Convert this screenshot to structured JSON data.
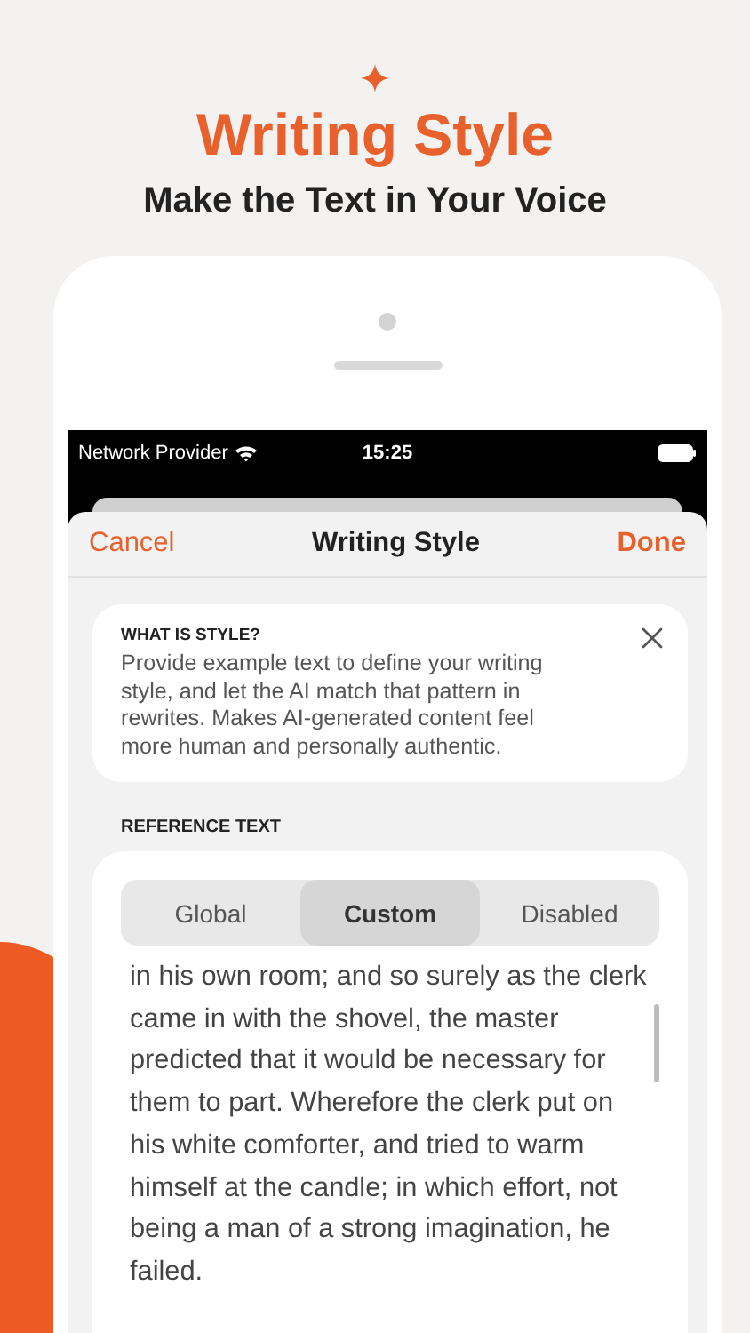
{
  "header": {
    "title": "Writing Style",
    "subtitle": "Make the Text in Your Voice"
  },
  "status_bar": {
    "carrier": "Network Provider",
    "time": "15:25"
  },
  "nav_bar": {
    "cancel": "Cancel",
    "title": "Writing Style",
    "done": "Done"
  },
  "info_card": {
    "heading": "WHAT IS STYLE?",
    "body": "Provide example text to define your writing style, and let the AI match that pattern in rewrites. Makes AI-generated content feel more human and personally authentic."
  },
  "reference": {
    "label": "REFERENCE TEXT",
    "segments": [
      {
        "label": "Global",
        "selected": false
      },
      {
        "label": "Custom",
        "selected": true
      },
      {
        "label": "Disabled",
        "selected": false
      }
    ],
    "text": "in his own room; and so surely as the clerk came in with the shovel, the master predicted that it would be necessary for them to part. Wherefore the clerk put on his white comforter, and tried to warm himself at the candle; in which effort, not being a man of a strong imagination, he failed."
  }
}
